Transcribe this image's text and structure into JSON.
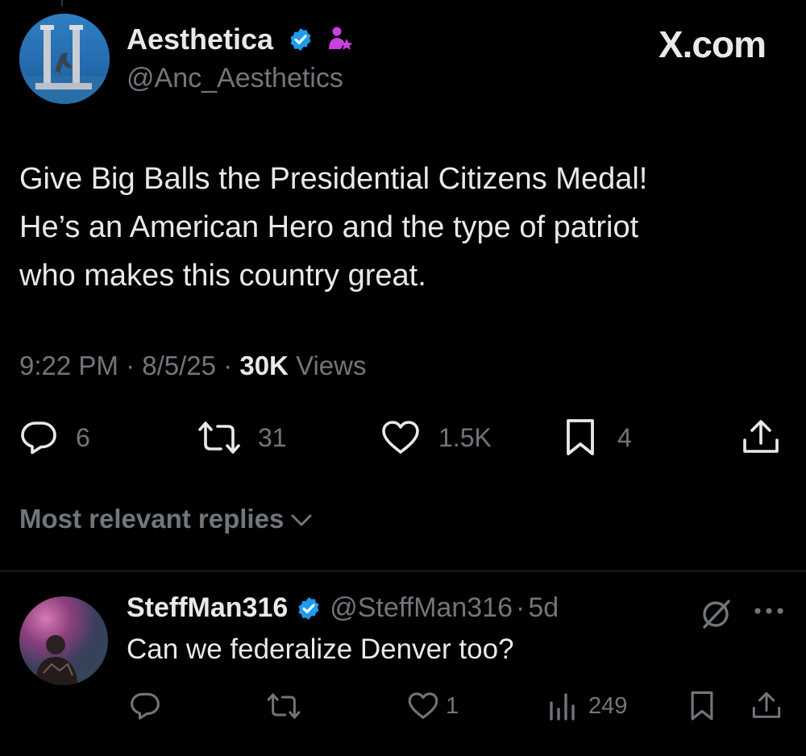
{
  "tweet": {
    "author_name": "Aesthetica",
    "author_handle": "@Anc_Aesthetics",
    "text_lines": [
      "Give Big Balls the Presidential Citizens Medal!",
      "He’s an American Hero and the type of patriot",
      "who makes this country great."
    ],
    "time": "9:22 PM",
    "date": "8/5/25",
    "views_count": "30K",
    "views_label": "Views",
    "separator": "·",
    "stats": {
      "replies": "6",
      "reposts": "31",
      "likes": "1.5K",
      "bookmarks": "4"
    }
  },
  "brand": "X.com",
  "replies_sort_label": "Most relevant replies",
  "reply": {
    "author_name": "SteffMan316",
    "author_handle": "@SteffMan316",
    "separator": "·",
    "age": "5d",
    "text": "Can we federalize Denver too?",
    "stats": {
      "likes": "1",
      "views": "249"
    }
  },
  "colors": {
    "background": "#000000",
    "text_primary": "#e7e9ea",
    "text_secondary": "#71767b",
    "verified_blue": "#1d9bf0",
    "affiliate_purple": "#c940e0",
    "divider": "#2f3336"
  },
  "icons": [
    "verified-badge-icon",
    "affiliate-icon",
    "reply-icon",
    "repost-icon",
    "like-icon",
    "bookmark-icon",
    "share-icon",
    "chevron-down-icon",
    "views-icon",
    "grok-icon",
    "more-icon"
  ]
}
